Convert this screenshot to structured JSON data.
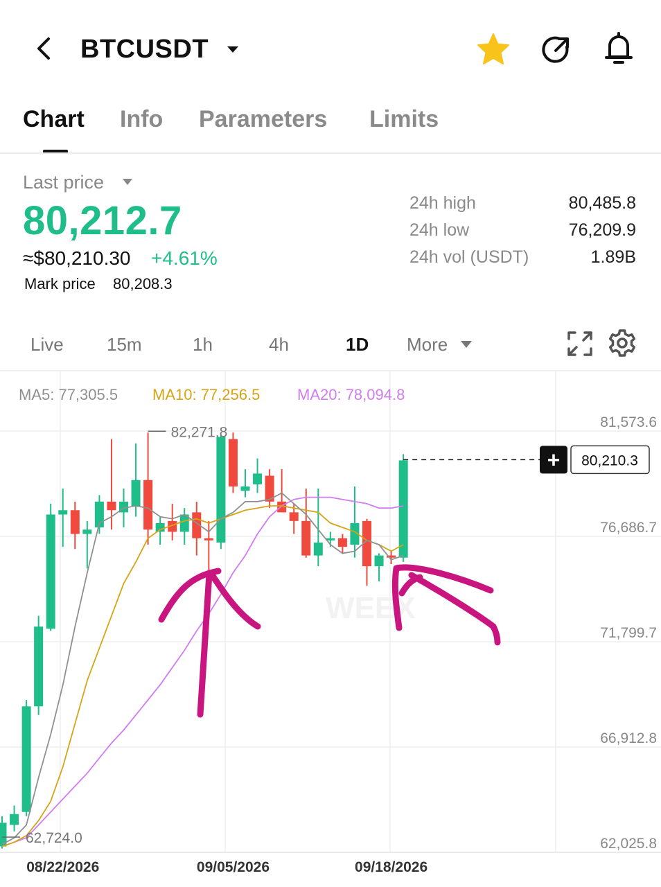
{
  "header": {
    "title": "BTCUSDT",
    "star_color": "#f8c41b"
  },
  "tabs": [
    {
      "label": "Chart",
      "active": true
    },
    {
      "label": "Info"
    },
    {
      "label": "Parameters"
    },
    {
      "label": "Limits"
    }
  ],
  "price": {
    "label": "Last price",
    "value": "80,212.7",
    "usd": "≈$80,210.30",
    "change": "+4.61%",
    "mark_label": "Mark price",
    "mark_value": "80,208.3",
    "up_color": "#1fbd8a"
  },
  "stats": [
    {
      "label": "24h high",
      "value": "80,485.8"
    },
    {
      "label": "24h low",
      "value": "76,209.9"
    },
    {
      "label": "24h vol (USDT)",
      "value": "1.89B"
    }
  ],
  "timeframes": [
    {
      "label": "Live"
    },
    {
      "label": "15m"
    },
    {
      "label": "1h"
    },
    {
      "label": "4h"
    },
    {
      "label": "1D",
      "active": true
    },
    {
      "label": "More"
    }
  ],
  "chart_data": {
    "type": "candlestick",
    "ma_labels": {
      "ma5": "MA5: 77,305.5",
      "ma10": "MA10: 77,256.5",
      "ma20": "MA20: 78,094.8"
    },
    "colors": {
      "up": "#1fbd8a",
      "down": "#f0493e",
      "ma5": "#909090",
      "ma10": "#d6a417",
      "ma20": "#d17cf0",
      "annotation": "#c8157f"
    },
    "y_ticks": [
      "81,573.6",
      "76,686.7",
      "71,799.7",
      "66,912.8",
      "62,025.8"
    ],
    "y_tick_values": [
      81573.6,
      76686.7,
      71799.7,
      66912.8,
      62025.8
    ],
    "x_ticks": [
      "08/22/2026",
      "09/05/2026",
      "09/18/2026"
    ],
    "x_tick_index": [
      5,
      19,
      32
    ],
    "high_label": "82,271.8",
    "low_label": "62,724.0",
    "current_price_label": "80,210.3",
    "watermark": "WEEX",
    "candles": [
      {
        "o": 62300,
        "h": 63700,
        "l": 62200,
        "c": 63400
      },
      {
        "o": 63300,
        "h": 64200,
        "l": 63000,
        "c": 63800
      },
      {
        "o": 63900,
        "h": 69100,
        "l": 63700,
        "c": 68800
      },
      {
        "o": 68800,
        "h": 73000,
        "l": 68400,
        "c": 72500
      },
      {
        "o": 72400,
        "h": 78200,
        "l": 72300,
        "c": 77700
      },
      {
        "o": 77700,
        "h": 78900,
        "l": 76200,
        "c": 77900
      },
      {
        "o": 77900,
        "h": 78300,
        "l": 76100,
        "c": 76800
      },
      {
        "o": 76800,
        "h": 77400,
        "l": 75200,
        "c": 77000
      },
      {
        "o": 77100,
        "h": 78600,
        "l": 76800,
        "c": 78300
      },
      {
        "o": 78300,
        "h": 81200,
        "l": 77000,
        "c": 77900
      },
      {
        "o": 77800,
        "h": 78900,
        "l": 77100,
        "c": 78300
      },
      {
        "o": 78100,
        "h": 81000,
        "l": 77600,
        "c": 79300
      },
      {
        "o": 79300,
        "h": 81500,
        "l": 76300,
        "c": 77000
      },
      {
        "o": 76900,
        "h": 77600,
        "l": 76300,
        "c": 77300
      },
      {
        "o": 77400,
        "h": 78200,
        "l": 76500,
        "c": 76900
      },
      {
        "o": 76900,
        "h": 78000,
        "l": 76300,
        "c": 77700
      },
      {
        "o": 77800,
        "h": 78300,
        "l": 75800,
        "c": 76600
      },
      {
        "o": 76600,
        "h": 77400,
        "l": 75100,
        "c": 76500
      },
      {
        "o": 76400,
        "h": 81400,
        "l": 76100,
        "c": 81300
      },
      {
        "o": 81200,
        "h": 81500,
        "l": 78700,
        "c": 79000
      },
      {
        "o": 78800,
        "h": 79800,
        "l": 78500,
        "c": 79000
      },
      {
        "o": 79100,
        "h": 80300,
        "l": 78700,
        "c": 79600
      },
      {
        "o": 79500,
        "h": 79800,
        "l": 78000,
        "c": 78300
      },
      {
        "o": 78300,
        "h": 79800,
        "l": 77800,
        "c": 77800
      },
      {
        "o": 77800,
        "h": 78200,
        "l": 76800,
        "c": 77400
      },
      {
        "o": 77400,
        "h": 78900,
        "l": 75700,
        "c": 75800
      },
      {
        "o": 75800,
        "h": 78900,
        "l": 75300,
        "c": 76400
      },
      {
        "o": 76500,
        "h": 76900,
        "l": 76200,
        "c": 76600
      },
      {
        "o": 76600,
        "h": 76800,
        "l": 75900,
        "c": 76200
      },
      {
        "o": 76300,
        "h": 79000,
        "l": 75700,
        "c": 77300
      },
      {
        "o": 77400,
        "h": 77500,
        "l": 74400,
        "c": 75300
      },
      {
        "o": 75300,
        "h": 75900,
        "l": 74600,
        "c": 75800
      },
      {
        "o": 75800,
        "h": 76000,
        "l": 75400,
        "c": 75700
      },
      {
        "o": 75700,
        "h": 80500,
        "l": 75500,
        "c": 80210
      }
    ],
    "ma5": [
      62400,
      62700,
      63300,
      65500,
      67500,
      69800,
      72500,
      75000,
      77300,
      77600,
      78000,
      78100,
      78000,
      77600,
      77500,
      77700,
      77300,
      76900,
      77500,
      77800,
      78300,
      78300,
      78400,
      78700,
      78200,
      77700,
      77000,
      76300,
      75900,
      76000,
      76500,
      76300,
      75600,
      75800
    ],
    "ma10": [
      62300,
      62500,
      62800,
      63500,
      64400,
      66000,
      68000,
      70000,
      71500,
      73000,
      74500,
      75500,
      76600,
      77000,
      77200,
      77400,
      77500,
      77300,
      77500,
      77700,
      77900,
      78000,
      78100,
      78100,
      78000,
      77900,
      77800,
      77300,
      77100,
      76900,
      76500,
      76300,
      76000,
      76300
    ],
    "ma20": [
      62300,
      62500,
      62700,
      63300,
      63900,
      64500,
      65100,
      65700,
      66400,
      67100,
      67700,
      68400,
      69100,
      69800,
      70600,
      71400,
      72300,
      73100,
      74000,
      75000,
      75800,
      76800,
      77600,
      78100,
      78400,
      78500,
      78500,
      78500,
      78400,
      78300,
      78200,
      78000,
      78000,
      78100
    ]
  },
  "chart_controls": {
    "add_order_label": "+"
  }
}
